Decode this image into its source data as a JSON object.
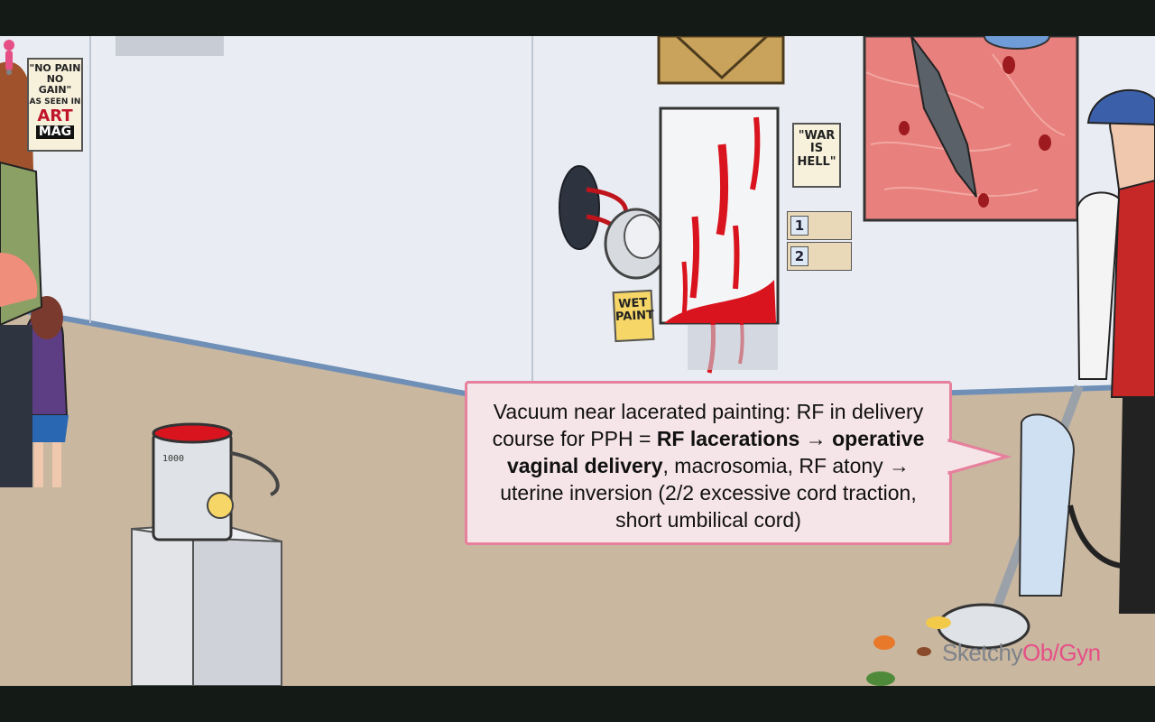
{
  "scene": {
    "colors": {
      "wall": "#e9edf3",
      "floor": "#c9b7a0",
      "blood": "#d9141e",
      "callout_bg": "#f5e4e8",
      "callout_border": "#e6809c",
      "brand_gray": "#7d8289",
      "brand_pink": "#e64f86"
    },
    "signs": {
      "no_pain_line1": "\"NO PAIN",
      "no_pain_line2": "NO GAIN\"",
      "as_seen_in": "AS SEEN IN",
      "art": "ART",
      "mag": "MAG",
      "war_line1": "\"WAR",
      "war_line2": "IS",
      "war_line3": "HELL\"",
      "wet_line1": "WET",
      "wet_line2": "PAINT"
    },
    "plaques": [
      "1",
      "2"
    ],
    "bucket_label": "1000"
  },
  "callout": {
    "part1": "Vacuum near lacerated painting: RF in delivery course for PPH = ",
    "bold1": "RF lacerations",
    "part2": " → ",
    "bold2": "operative vaginal delivery",
    "part3": ", macrosomia, RF atony → uterine inversion (2/2 excessive cord traction, short umbilical cord)"
  },
  "brand": {
    "part1": "Sketchy",
    "part2": "Ob/Gyn"
  }
}
